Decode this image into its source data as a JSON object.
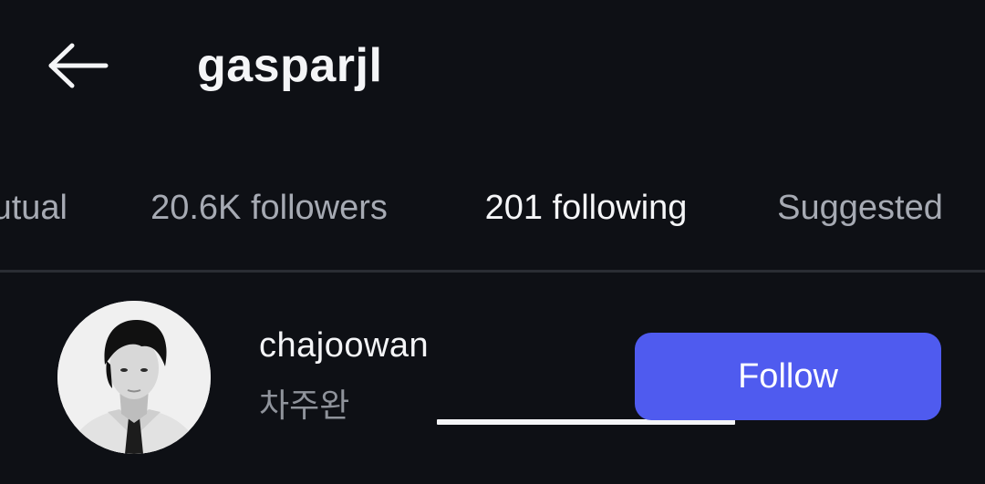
{
  "header": {
    "title": "gasparjl",
    "back_icon": "arrow-left-icon"
  },
  "tabs": [
    {
      "label": "Mutual",
      "visible_text": "utual",
      "active": false
    },
    {
      "label": "20.6K followers",
      "active": false
    },
    {
      "label": "201 following",
      "active": true
    },
    {
      "label": "Suggested",
      "active": false
    }
  ],
  "list": {
    "items": [
      {
        "username": "chajoowan",
        "fullname": "차주완",
        "action_label": "Follow",
        "avatar_icon": "profile-photo"
      }
    ]
  },
  "colors": {
    "background": "#0e1015",
    "accent": "#4f5bef",
    "text_primary": "#f4f5f7",
    "text_secondary": "#a6aab3",
    "divider": "#2a2d33"
  }
}
